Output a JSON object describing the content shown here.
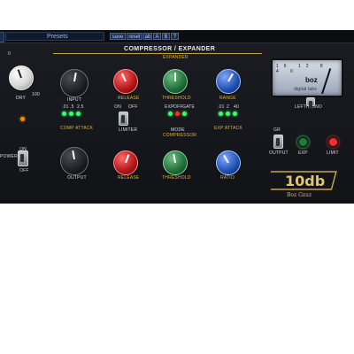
{
  "toolbar": {
    "presets_label": "Presets",
    "save_label": "save",
    "reset_label": "reset",
    "btn_ab": "ab",
    "btn_a": "A",
    "btn_b": "B",
    "btn_help": "?"
  },
  "section": {
    "title": "COMPRESSOR / EXPANDER",
    "expander": "EXPANDER",
    "compressor": "COMPRESSOR"
  },
  "left": {
    "dry_label": "DRY",
    "dry_scale": [
      "0",
      "100"
    ],
    "power_label": "POWER",
    "power_on": "ON",
    "power_off": "OFF",
    "output_label": "OUTPUT"
  },
  "top_row": {
    "input_label": "INPUT",
    "release_label": "RELEASE",
    "threshold_label": "THRESHOLD",
    "range_label": "RANGE"
  },
  "middle": {
    "comp_attack_label": "COMP ATTACK",
    "comp_attack_vals": [
      ".01",
      ".5",
      "2.5"
    ],
    "limiter_label": "LIMITER",
    "limiter_on": "ON",
    "limiter_off": "OFF",
    "mode_label": "MODE",
    "mode_vals": [
      "EXP",
      "OFF",
      "GATE"
    ],
    "exp_attack_label": "EXP ATTACK",
    "exp_attack_vals": [
      ".01",
      "2",
      "40"
    ]
  },
  "bottom_row": {
    "output_label": "OUTPUT",
    "release_label": "RELEASE",
    "threshold_label": "THRESHOLD",
    "ratio_label": "RATIO"
  },
  "meter": {
    "scale": [
      "16",
      "12",
      "8",
      "4",
      "0"
    ],
    "brand": "boz",
    "subtitle": "digital labs",
    "mode_label": "LEFT/MONO"
  },
  "right_controls": {
    "gr_label": "GR",
    "output_label": "OUTPUT",
    "exp_label": "EXP",
    "limit_label": "LIMIT"
  },
  "logo": {
    "main": "10db",
    "signature": "Boz Gzuz"
  },
  "colors": {
    "accent_gold": "#d9b24a",
    "led_green": "#39ff6a",
    "led_red": "#ff2a2a",
    "led_orange": "#ff8a00"
  }
}
